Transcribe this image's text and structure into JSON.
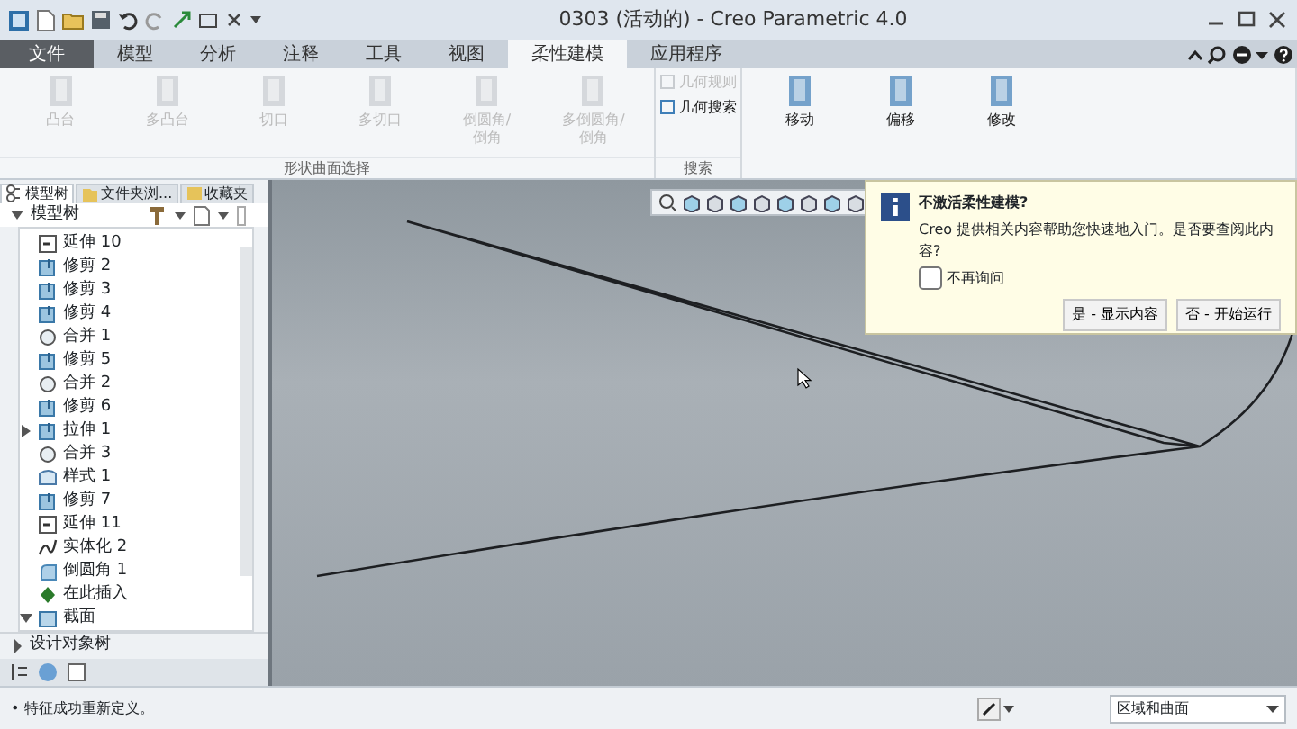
{
  "window": {
    "title": "0303 (活动的) - Creo Parametric 4.0"
  },
  "ribbon_tabs": [
    {
      "label": "文件",
      "selected": false,
      "kind": "file"
    },
    {
      "label": "模型",
      "selected": false,
      "kind": "tab"
    },
    {
      "label": "分析",
      "selected": false,
      "kind": "tab"
    },
    {
      "label": "注释",
      "selected": false,
      "kind": "tab"
    },
    {
      "label": "工具",
      "selected": false,
      "kind": "tab"
    },
    {
      "label": "视图",
      "selected": false,
      "kind": "tab"
    },
    {
      "label": "柔性建模",
      "selected": true,
      "kind": "tab"
    },
    {
      "label": "应用程序",
      "selected": false,
      "kind": "tab"
    }
  ],
  "ribbon_groups": [
    {
      "label": "形状曲面选择",
      "buttons": [
        {
          "label": "凸台",
          "disabled": true
        },
        {
          "label": "多凸台",
          "disabled": true
        },
        {
          "label": "切口",
          "disabled": true
        },
        {
          "label": "多切口",
          "disabled": true
        },
        {
          "label": "倒圆角/\n倒角",
          "disabled": true
        },
        {
          "label": "多倒圆角/\n倒角",
          "disabled": true
        }
      ]
    },
    {
      "label": "搜索",
      "buttons": [
        {
          "label": "几何规则",
          "disabled": true
        },
        {
          "label": "几何搜索",
          "disabled": false
        }
      ]
    },
    {
      "buttons": [
        {
          "label": "移动",
          "disabled": false
        },
        {
          "label": "偏移",
          "disabled": false
        },
        {
          "label": "修改",
          "disabled": false
        }
      ]
    }
  ],
  "model_panel": {
    "tabs": [
      {
        "label": "模型树",
        "selected": true
      },
      {
        "label": "文件夹浏...",
        "selected": false
      },
      {
        "label": "收藏夹",
        "selected": false
      }
    ],
    "tree_title": "模型树",
    "tree_items": [
      {
        "label": "延伸 10",
        "kind": "extend"
      },
      {
        "label": "修剪 2",
        "kind": "trim"
      },
      {
        "label": "修剪 3",
        "kind": "trim"
      },
      {
        "label": "修剪 4",
        "kind": "trim"
      },
      {
        "label": "合并 1",
        "kind": "merge"
      },
      {
        "label": "修剪 5",
        "kind": "trim"
      },
      {
        "label": "合并 2",
        "kind": "merge"
      },
      {
        "label": "修剪 6",
        "kind": "trim"
      },
      {
        "label": "拉伸 1",
        "kind": "trim",
        "expanded": false
      },
      {
        "label": "合并 3",
        "kind": "merge"
      },
      {
        "label": "样式 1",
        "kind": "style"
      },
      {
        "label": "修剪 7",
        "kind": "trim"
      },
      {
        "label": "延伸 11",
        "kind": "extend"
      },
      {
        "label": "实体化 2",
        "kind": "solidify"
      },
      {
        "label": "倒圆角 1",
        "kind": "round"
      },
      {
        "label": "在此插入",
        "kind": "insert"
      },
      {
        "label": "截面",
        "kind": "section",
        "expanded": true
      }
    ],
    "design_tree": "设计对象树"
  },
  "dialog": {
    "title": "不激活柔性建模?",
    "message": "Creo 提供相关内容帮助您快速地入门。是否要查阅此内容?",
    "checkbox": {
      "label": "不再询问",
      "checked": false
    },
    "buttons": [
      "是 - 显示内容",
      "否 - 开始运行"
    ]
  },
  "status_bar": {
    "message": "• 特征成功重新定义。",
    "filter": "区域和曲面"
  }
}
